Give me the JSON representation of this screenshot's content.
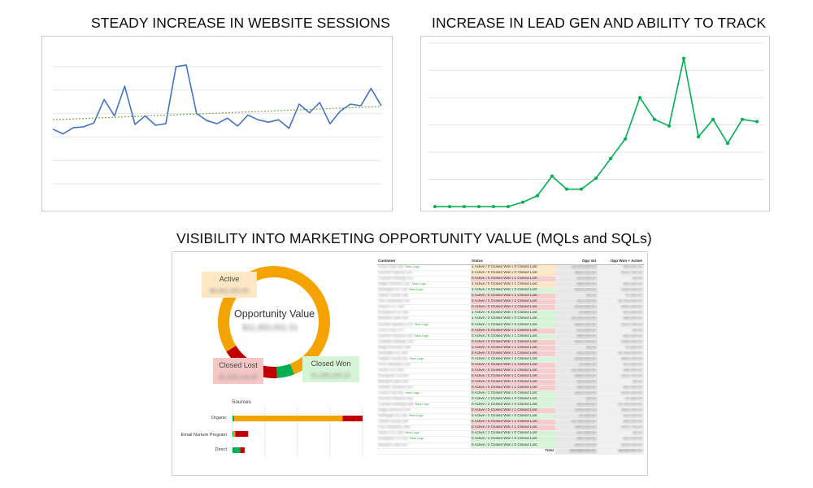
{
  "headings": {
    "sessions": "STEADY INCREASE IN WEBSITE SESSIONS",
    "leads": "INCREASE IN LEAD GEN AND ABILITY TO TRACK",
    "visibility": "VISIBILITY INTO MARKETING OPPORTUNITY VALUE (MQLs and SQLs)"
  },
  "colors": {
    "sessions_line": "#4472c4",
    "trendline": "#70ad47",
    "leads_line": "#00b050",
    "active": "#f5a300",
    "closed_lost": "#c00000",
    "closed_won": "#00b050"
  },
  "chart_data": [
    {
      "type": "line",
      "title": "STEADY INCREASE IN WEBSITE SESSIONS",
      "x": [
        1,
        2,
        3,
        4,
        5,
        6,
        7,
        8,
        9,
        10,
        11,
        12,
        13,
        14,
        15,
        16,
        17,
        18,
        19,
        20,
        21,
        22,
        23,
        24,
        25,
        26,
        27,
        28,
        29,
        30,
        31,
        32,
        33,
        34,
        35
      ],
      "series": [
        {
          "values": [
            100,
            94,
            102,
            103,
            108,
            138,
            117,
            155,
            106,
            117,
            105,
            107,
            180,
            182,
            120,
            111,
            107,
            114,
            104,
            118,
            112,
            109,
            112,
            101,
            132,
            121,
            134,
            107,
            123,
            132,
            130,
            152,
            130
          ]
        }
      ],
      "trendline": {
        "style": "dotted",
        "from": 112,
        "to": 129
      },
      "ylim": [
        0,
        210
      ],
      "grid": true
    },
    {
      "type": "line",
      "title": "INCREASE IN LEAD GEN AND ABILITY TO TRACK",
      "series": [
        {
          "values": [
            0,
            0,
            0,
            0,
            0,
            0,
            2,
            5,
            14,
            8,
            8,
            13,
            22,
            31,
            50,
            40,
            37,
            68,
            32,
            40,
            29,
            40,
            39
          ]
        }
      ],
      "ylim": [
        0,
        75
      ],
      "grid": true
    },
    {
      "type": "pie",
      "title": "Opportunity Value",
      "categories": [
        "Active",
        "Closed Won",
        "Closed Lost"
      ],
      "values": [
        78,
        5,
        17
      ],
      "center_label": "Opportunity Value"
    },
    {
      "type": "bar",
      "orientation": "horizontal",
      "title": "Sources",
      "categories": [
        "Organic",
        "Email Nurture Program",
        "Direct"
      ],
      "series": [
        {
          "name": "Closed Won",
          "values": [
            2,
            1,
            9
          ]
        },
        {
          "name": "Active",
          "values": [
            125,
            2,
            0
          ]
        },
        {
          "name": "Closed Lost",
          "values": [
            23,
            15,
            5
          ]
        }
      ],
      "grid": true
    }
  ],
  "donut": {
    "center_label": "Opportunity Value",
    "active_label": "Active",
    "closed_lost_label": "Closed Lost",
    "closed_won_label": "Closed Won"
  },
  "sources": {
    "title": "Sources",
    "rows": [
      "Organic",
      "Email Nurture Program",
      "Direct"
    ]
  },
  "table": {
    "headers": [
      "Customer",
      "Status",
      "Opp Val",
      "Opp Won + Active"
    ],
    "new_logo": "New Logo",
    "total_label": "Total",
    "rows": [
      {
        "status": "1 Active / 0 Closed Won / 0 Closed Lost",
        "tone": "orange",
        "new": true
      },
      {
        "status": "2 Active / 0 Closed Won / 0 Closed Lost",
        "tone": "orange",
        "new": false
      },
      {
        "status": "0 Active / 0 Closed Won / 1 Closed Lost",
        "tone": "red",
        "new": false
      },
      {
        "status": "1 Active / 0 Closed Won / 1 Closed Lost",
        "tone": "orange",
        "new": true
      },
      {
        "status": "1 Active / 4 Closed Won / 2 Closed Lost",
        "tone": "green",
        "new": true
      },
      {
        "status": "0 Active / 0 Closed Won / 1 Closed Lost",
        "tone": "red",
        "new": false
      },
      {
        "status": "0 Active / 0 Closed Won / 2 Closed Lost",
        "tone": "red",
        "new": false
      },
      {
        "status": "0 Active / 0 Closed Won / 2 Closed Lost",
        "tone": "red",
        "new": false
      },
      {
        "status": "1 Active / 6 Closed Won / 0 Closed Lost",
        "tone": "green",
        "new": false
      },
      {
        "status": "1 Active / 2 Closed Won / 0 Closed Lost",
        "tone": "green",
        "new": false
      },
      {
        "status": "0 Active / 1 Closed Won / 0 Closed Lost",
        "tone": "green",
        "new": true
      },
      {
        "status": "0 Active / 0 Closed Won / 1 Closed Lost",
        "tone": "red",
        "new": false
      },
      {
        "status": "0 Active / 6 Closed Won / 1 Closed Lost",
        "tone": "green",
        "new": true
      },
      {
        "status": "0 Active / 0 Closed Won / 1 Closed Lost",
        "tone": "red",
        "new": false
      },
      {
        "status": "0 Active / 0 Closed Won / 1 Closed Lost",
        "tone": "red",
        "new": false
      },
      {
        "status": "0 Active / 0 Closed Won / 1 Closed Lost",
        "tone": "red",
        "new": false
      },
      {
        "status": "0 Active / 4 Closed Won / 3 Closed Lost",
        "tone": "green",
        "new": true
      },
      {
        "status": "0 Active / 0 Closed Won / 1 Closed Lost",
        "tone": "red",
        "new": false
      },
      {
        "status": "0 Active / 0 Closed Won / 1 Closed Lost",
        "tone": "red",
        "new": false
      },
      {
        "status": "0 Active / 0 Closed Won / 1 Closed Lost",
        "tone": "red",
        "new": false
      },
      {
        "status": "0 Active / 0 Closed Won / 2 Closed Lost",
        "tone": "red",
        "new": false
      },
      {
        "status": "0 Active / 0 Closed Won / 1 Closed Lost",
        "tone": "red",
        "new": false
      },
      {
        "status": "0 Active / 1 Closed Won / 0 Closed Lost",
        "tone": "green",
        "new": true
      },
      {
        "status": "0 Active / 1 Closed Won / 0 Closed Lost",
        "tone": "green",
        "new": false
      },
      {
        "status": "0 Active / 2 Closed Won / 0 Closed Lost",
        "tone": "green",
        "new": true
      },
      {
        "status": "0 Active / 0 Closed Won / 1 Closed Lost",
        "tone": "red",
        "new": false
      },
      {
        "status": "0 Active / 2 Closed Won / 0 Closed Lost",
        "tone": "green",
        "new": true
      },
      {
        "status": "0 Active / 0 Closed Won / 1 Closed Lost",
        "tone": "red",
        "new": false
      },
      {
        "status": "0 Active / 0 Closed Won / 1 Closed Lost",
        "tone": "red",
        "new": false
      },
      {
        "status": "0 Active / 1 Closed Won / 0 Closed Lost",
        "tone": "green",
        "new": true
      },
      {
        "status": "0 Active / 1 Closed Won / 0 Closed Lost",
        "tone": "green",
        "new": true
      },
      {
        "status": "0 Active / 2 Closed Won / 0 Closed Lost",
        "tone": "green",
        "new": false
      }
    ]
  }
}
